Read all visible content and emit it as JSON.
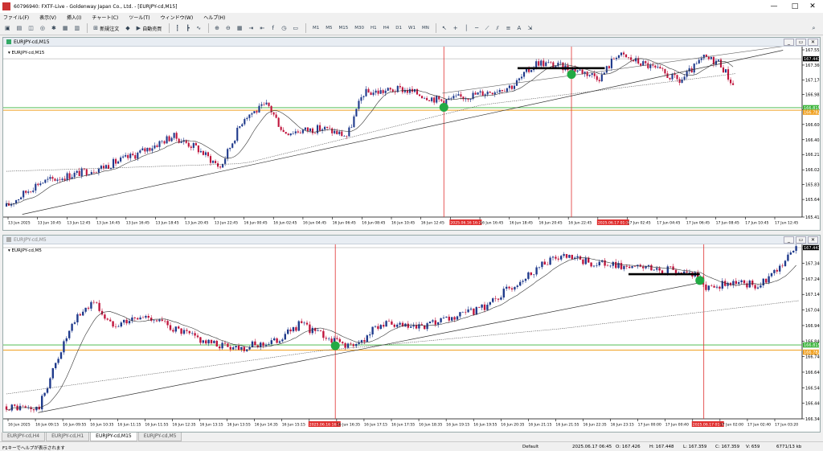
{
  "window_title": "60796940: FXTF-Live - Goldenway Japan Co., Ltd. - [EURJPY-cd,M15]",
  "window_controls": [
    "—",
    "□",
    "✕"
  ],
  "menu": [
    "ファイル(F)",
    "表示(V)",
    "挿入(I)",
    "チャート(C)",
    "ツール(T)",
    "ウィンドウ(W)",
    "ヘルプ(H)"
  ],
  "toolbar": {
    "new_order": "新規注文",
    "auto_trade": "自動売買",
    "timeframes": [
      "M1",
      "M5",
      "M15",
      "M30",
      "H1",
      "H4",
      "D1",
      "W1",
      "MN"
    ]
  },
  "charts": [
    {
      "window_title": "EURJPY-cd,M15",
      "label": "EURJPY-cd,M15",
      "ymin": 165.415,
      "ymax": 167.555,
      "ticks": [
        167.555,
        167.36,
        167.17,
        166.985,
        166.79,
        166.6,
        166.405,
        166.215,
        166.02,
        165.83,
        165.64,
        165.415
      ],
      "current_price": "167.441",
      "green_level": 166.815,
      "green_label": "166.815",
      "orange_level": 166.782,
      "orange_label": "166.782",
      "x_labels": [
        "13 Jun 2025",
        "13 Jun 10:45",
        "13 Jun 12:45",
        "13 Jun 14:45",
        "13 Jun 16:45",
        "13 Jun 18:45",
        "13 Jun 20:45",
        "13 Jun 22:45",
        "16 Jun 00:45",
        "16 Jun 02:45",
        "16 Jun 04:45",
        "16 Jun 06:45",
        "16 Jun 08:45",
        "16 Jun 10:45",
        "16 Jun 12:45",
        "2025.06.16 16:25",
        "16 Jun 16:45",
        "16 Jun 18:45",
        "16 Jun 20:45",
        "16 Jun 22:45",
        "2025.06.17 01:30",
        "17 Jun 02:45",
        "17 Jun 04:45",
        "17 Jun 06:45",
        "17 Jun 08:45",
        "17 Jun 10:45",
        "17 Jun 12:45"
      ],
      "highlight_labels": [
        15,
        20
      ]
    },
    {
      "window_title": "EURJPY-cd,M5",
      "label": "EURJPY-cd,M5",
      "ymin": 166.34,
      "ymax": 167.441,
      "ticks": [
        167.441,
        167.34,
        167.24,
        167.14,
        167.04,
        166.94,
        166.84,
        166.74,
        166.64,
        166.54,
        166.44,
        166.34
      ],
      "current_price": "167.441",
      "green_level": 166.815,
      "green_label": "166.815",
      "orange_level": 166.782,
      "orange_label": "166.782",
      "x_labels": [
        "16 Jun 2025",
        "16 Jun 09:15",
        "16 Jun 09:55",
        "16 Jun 10:35",
        "16 Jun 11:15",
        "16 Jun 11:55",
        "16 Jun 12:35",
        "16 Jun 13:15",
        "16 Jun 13:55",
        "16 Jun 14:35",
        "16 Jun 15:15",
        "2025.06.16 16:25",
        "16 Jun 16:35",
        "16 Jun 17:15",
        "16 Jun 17:55",
        "16 Jun 18:35",
        "16 Jun 19:15",
        "16 Jun 19:55",
        "16 Jun 20:35",
        "16 Jun 21:15",
        "16 Jun 21:55",
        "16 Jun 22:35",
        "16 Jun 23:15",
        "17 Jun 00:00",
        "17 Jun 00:40",
        "2025.06.17 01:30",
        "17 Jun 02:00",
        "17 Jun 02:40",
        "17 Jun 03:20"
      ],
      "highlight_labels": [
        11,
        25
      ]
    }
  ],
  "tabs": [
    "EURJPY-cd,H4",
    "EURJPY-cd,H1",
    "EURJPY-cd,M15",
    "EURJPY-cd,M5"
  ],
  "active_tab": 2,
  "status": {
    "help": "F1キーでヘルプが表示されます",
    "profile": "Default",
    "datetime": "2025.06.17 06:45",
    "open": "O: 167.426",
    "high": "H: 167.448",
    "low": "L: 167.359",
    "close": "C: 167.359",
    "volume": "V: 659",
    "traffic": "6771/13 kb"
  },
  "colors": {
    "bull": "#1f3a8c",
    "bear": "#c0143c",
    "green_line": "#3cb43c",
    "orange_line": "#f0a020",
    "vline": "#e03030",
    "marker": "#22aa44"
  }
}
